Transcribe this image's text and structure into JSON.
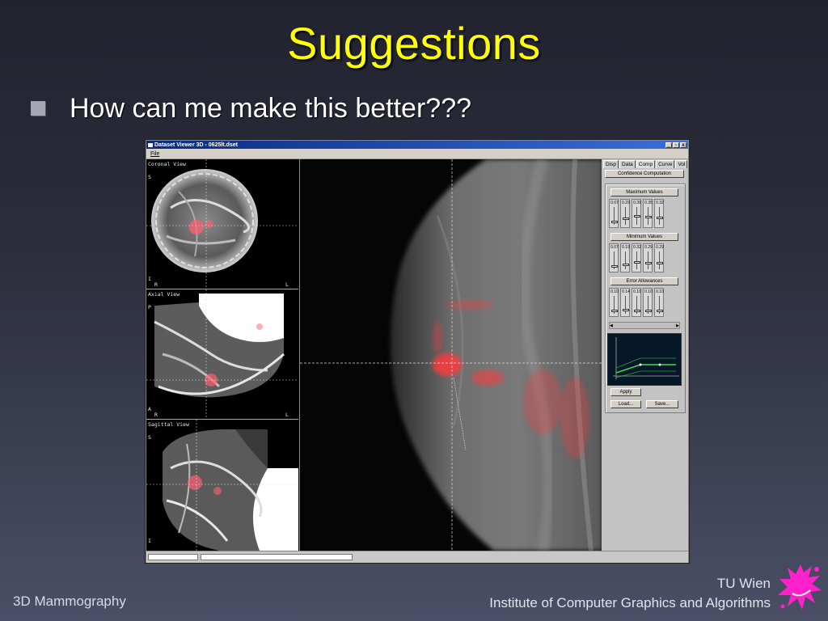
{
  "slide": {
    "title": "Suggestions",
    "bullet": "How can me make this better???",
    "footer_left": "3D Mammography",
    "footer_right_line1": "TU Wien",
    "footer_right_line2": "Institute of Computer Graphics and Algorithms"
  },
  "window": {
    "title": "Dataset Viewer 3D - 0625lt.dset",
    "menu": [
      "File"
    ],
    "controls": [
      "_",
      "▫",
      "x"
    ]
  },
  "views": {
    "coronal": {
      "label": "Coronal View",
      "top": "S",
      "bottom": "I",
      "bottom_left": "R",
      "bottom_right": "L"
    },
    "axial": {
      "label": "Axial View",
      "top": "P",
      "bottom": "A",
      "bottom_left": "R",
      "bottom_right": "L"
    },
    "sagittal": {
      "label": "Sagittal View",
      "top": "S",
      "bottom": "I"
    }
  },
  "panel": {
    "tabs": [
      "Disp",
      "Data",
      "Comp",
      "Curve",
      "Vol"
    ],
    "active_tab": "Comp",
    "confidence_button": "Confidence Computation",
    "sections": [
      {
        "label": "Maximum Values",
        "values": [
          "0.07",
          "0.29",
          "0.39",
          "0.35",
          "0.32"
        ],
        "levels": [
          0.07,
          0.29,
          0.39,
          0.35,
          0.32
        ]
      },
      {
        "label": "Minimum Values",
        "values": [
          "0.07",
          "0.19",
          "0.32",
          "0.29",
          "0.29"
        ],
        "levels": [
          0.07,
          0.19,
          0.32,
          0.29,
          0.29
        ]
      },
      {
        "label": "Error Allowances",
        "values": [
          "0.10",
          "0.14",
          "0.10",
          "0.10",
          "0.10"
        ],
        "levels": [
          0.1,
          0.14,
          0.1,
          0.1,
          0.1
        ]
      }
    ],
    "apply_label": "Apply",
    "load_label": "Load...",
    "save_label": "Save..."
  },
  "colors": {
    "title": "#ffff00",
    "highlight": "#ff3a3a",
    "curve": "#3fd95a"
  }
}
